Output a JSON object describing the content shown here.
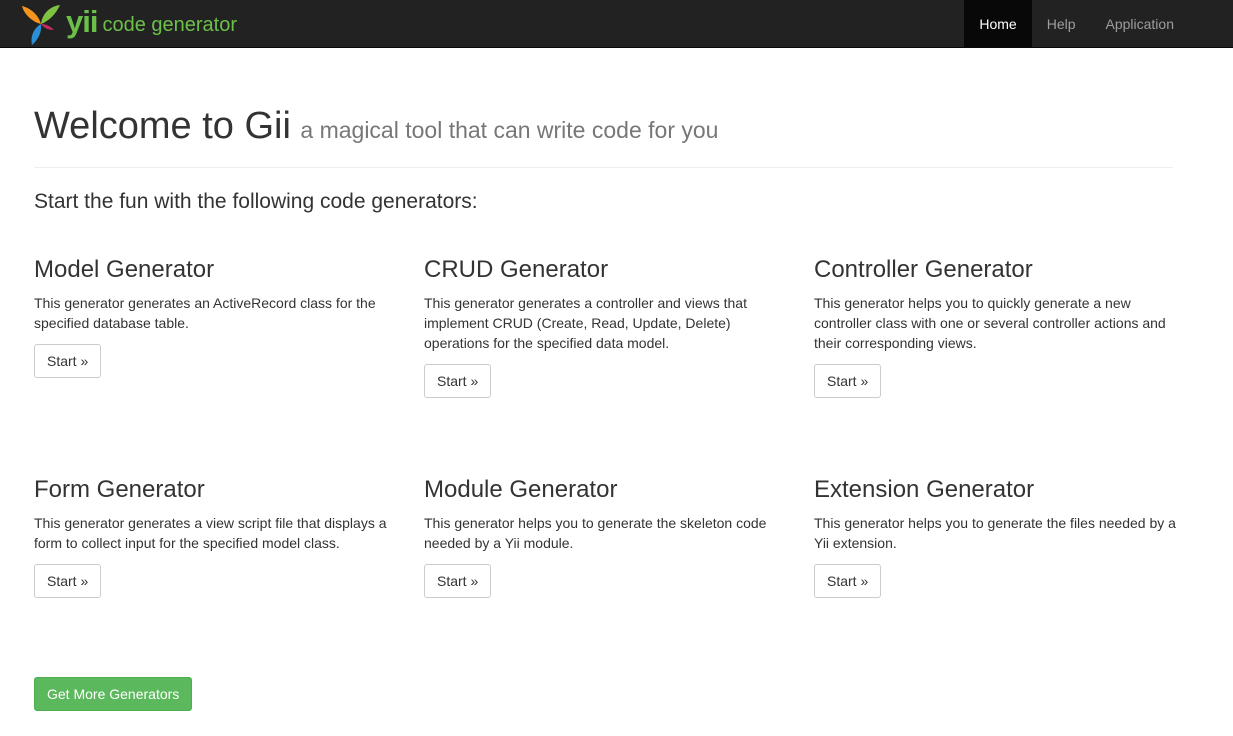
{
  "navbar": {
    "brand_logo_text": "yii",
    "brand_subtitle": "code generator",
    "items": [
      {
        "label": "Home",
        "active": true
      },
      {
        "label": "Help",
        "active": false
      },
      {
        "label": "Application",
        "active": false
      }
    ]
  },
  "header": {
    "title": "Welcome to Gii",
    "subtitle": "a magical tool that can write code for you"
  },
  "lead": "Start the fun with the following code generators:",
  "generators": [
    {
      "title": "Model Generator",
      "description": "This generator generates an ActiveRecord class for the specified database table.",
      "button_label": "Start »"
    },
    {
      "title": "CRUD Generator",
      "description": "This generator generates a controller and views that implement CRUD (Create, Read, Update, Delete) operations for the specified data model.",
      "button_label": "Start »"
    },
    {
      "title": "Controller Generator",
      "description": "This generator helps you to quickly generate a new controller class with one or several controller actions and their corresponding views.",
      "button_label": "Start »"
    },
    {
      "title": "Form Generator",
      "description": "This generator generates a view script file that displays a form to collect input for the specified model class.",
      "button_label": "Start »"
    },
    {
      "title": "Module Generator",
      "description": "This generator helps you to generate the skeleton code needed by a Yii module.",
      "button_label": "Start »"
    },
    {
      "title": "Extension Generator",
      "description": "This generator helps you to generate the files needed by a Yii extension.",
      "button_label": "Start »"
    }
  ],
  "more_button_label": "Get More Generators",
  "colors": {
    "navbar_bg": "#222222",
    "brand_green": "#6cc04a",
    "success_button": "#5cb85c"
  }
}
